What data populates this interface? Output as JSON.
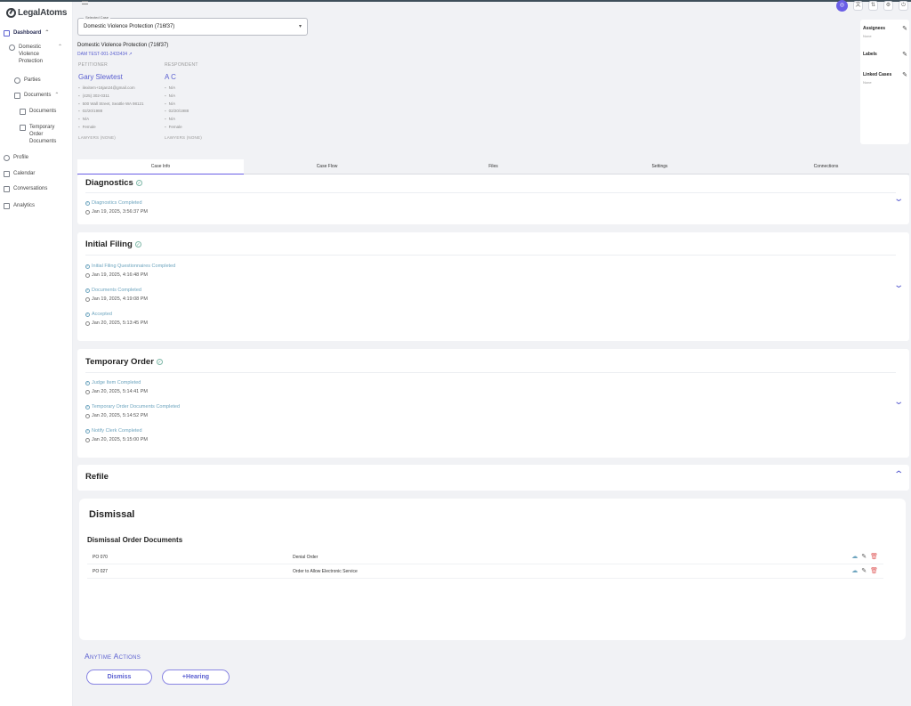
{
  "app": {
    "logo_text": "LegalAtoms"
  },
  "sidebar": {
    "items": [
      {
        "label": "Dashboard"
      },
      {
        "label": "Domestic Violence Protection"
      },
      {
        "label": "Parties"
      },
      {
        "label": "Documents"
      },
      {
        "label": "Documents"
      },
      {
        "label": "Temporary Order Documents"
      },
      {
        "label": "Profile"
      },
      {
        "label": "Calendar"
      },
      {
        "label": "Conversations"
      },
      {
        "label": "Analytics"
      }
    ]
  },
  "case_select": {
    "label": "Selected Case",
    "value": "Domestic Violence Protection (716f37)"
  },
  "case": {
    "title": "Domestic Violence Protection (716f37)",
    "case_id": "DAM TEST-001-2433434"
  },
  "petitioner": {
    "role": "PETITIONER",
    "name": "Gary Slewtest",
    "email": "ilexitem+16jan24@gmail.com",
    "phone": "(425) 302-0311",
    "address": "500 Wall Street, Seattle WA 98121",
    "dob": "02/20/1988",
    "extra": "N/A",
    "gender": "Female",
    "lawyers": "LAWYERS (NONE)"
  },
  "respondent": {
    "role": "RESPONDENT",
    "name": "A C",
    "email": "N/A",
    "phone": "N/A",
    "address": "N/A",
    "dob": "02/20/1988",
    "extra": "N/A",
    "gender": "Female",
    "lawyers": "LAWYERS (NONE)"
  },
  "right_panel": {
    "assignees": {
      "title": "Assignees",
      "value": "None"
    },
    "labels": {
      "title": "Labels"
    },
    "linked_cases": {
      "title": "Linked Cases",
      "value": "None"
    }
  },
  "tabs": [
    {
      "label": "Case Info"
    },
    {
      "label": "Case Flow"
    },
    {
      "label": "Files"
    },
    {
      "label": "Settings"
    },
    {
      "label": "Connections"
    }
  ],
  "sections": {
    "diagnostics": {
      "title": "Diagnostics",
      "steps": [
        {
          "label": "Diagnostics Completed",
          "time": "Jan 19, 2025, 3:56:37 PM"
        }
      ]
    },
    "initial_filing": {
      "title": "Initial Filing",
      "steps": [
        {
          "label": "Initial Filing Questionnaires Completed",
          "time": "Jan 19, 2025, 4:16:48 PM"
        },
        {
          "label": "Documents Completed",
          "time": "Jan 19, 2025, 4:19:08 PM"
        },
        {
          "label": "Accepted",
          "time": "Jan 20, 2025, 5:13:45 PM"
        }
      ]
    },
    "temporary_order": {
      "title": "Temporary Order",
      "steps": [
        {
          "label": "Judge Item Completed",
          "time": "Jan 20, 2025, 5:14:41 PM"
        },
        {
          "label": "Temporary Order Documents Completed",
          "time": "Jan 20, 2025, 5:14:52 PM"
        },
        {
          "label": "Notify Clerk Completed",
          "time": "Jan 20, 2025, 5:15:00 PM"
        }
      ]
    },
    "refile": {
      "title": "Refile"
    },
    "dismissal": {
      "title": "Dismissal",
      "docs_title": "Dismissal Order Documents",
      "docs": [
        {
          "code": "PO 070",
          "name": "Denial Order"
        },
        {
          "code": "PO 027",
          "name": "Order to Allow Electronic Service"
        }
      ]
    }
  },
  "anytime_actions": {
    "title": "Anytime Actions",
    "buttons": [
      {
        "label": "Dismiss"
      },
      {
        "label": "+Hearing"
      }
    ]
  },
  "colors": {
    "accent": "#5a5fd0",
    "success": "#7fb8a8",
    "danger": "#e06060",
    "link_teal": "#6ea5bf"
  }
}
